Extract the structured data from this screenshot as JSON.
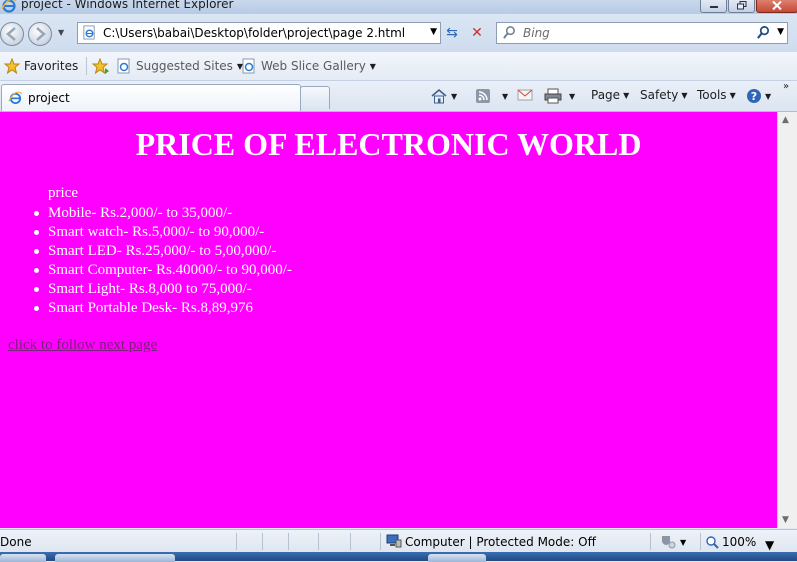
{
  "window": {
    "title": "project - Windows Internet Explorer"
  },
  "toolbar": {
    "address": "C:\\Users\\babai\\Desktop\\folder\\project\\page 2.html",
    "search_placeholder": "Bing"
  },
  "favorites_bar": {
    "favorites_label": "Favorites",
    "suggested_sites_label": "Suggested Sites",
    "web_slice_gallery_label": "Web Slice Gallery"
  },
  "tabs": [
    {
      "label": "project",
      "active": true
    }
  ],
  "command_bar": {
    "page_label": "Page",
    "safety_label": "Safety",
    "tools_label": "Tools"
  },
  "content": {
    "background_color": "#ff00ff",
    "heading": "PRICE OF ELECTRONIC WORLD",
    "price_label": "price",
    "items": [
      "Mobile- Rs.2,000/- to 35,000/-",
      "Smart watch- Rs.5,000/- to 90,000/-",
      "Smart LED- Rs.25,000/- to 5,00,000/-",
      "Smart Computer- Rs.40000/- to 90,000/-",
      "Smart Light- Rs.8,000 to 75,000/-",
      "Smart Portable Desk- Rs.8,89,976"
    ],
    "link_text": "click to follow next page"
  },
  "status_bar": {
    "status_text": "Done",
    "zone_text": "Computer | Protected Mode: Off",
    "zoom": "100%"
  },
  "icons": {
    "browser_logo": "ie-logo-icon",
    "back": "back-arrow-icon",
    "forward": "forward-arrow-icon",
    "refresh": "refresh-icon",
    "stop": "stop-icon",
    "search": "search-icon",
    "favorites": "star-icon",
    "home": "home-icon",
    "feeds": "rss-icon",
    "mail": "mail-icon",
    "print": "printer-icon",
    "help": "help-icon",
    "zone": "computer-icon",
    "zoom": "magnifier-icon"
  }
}
